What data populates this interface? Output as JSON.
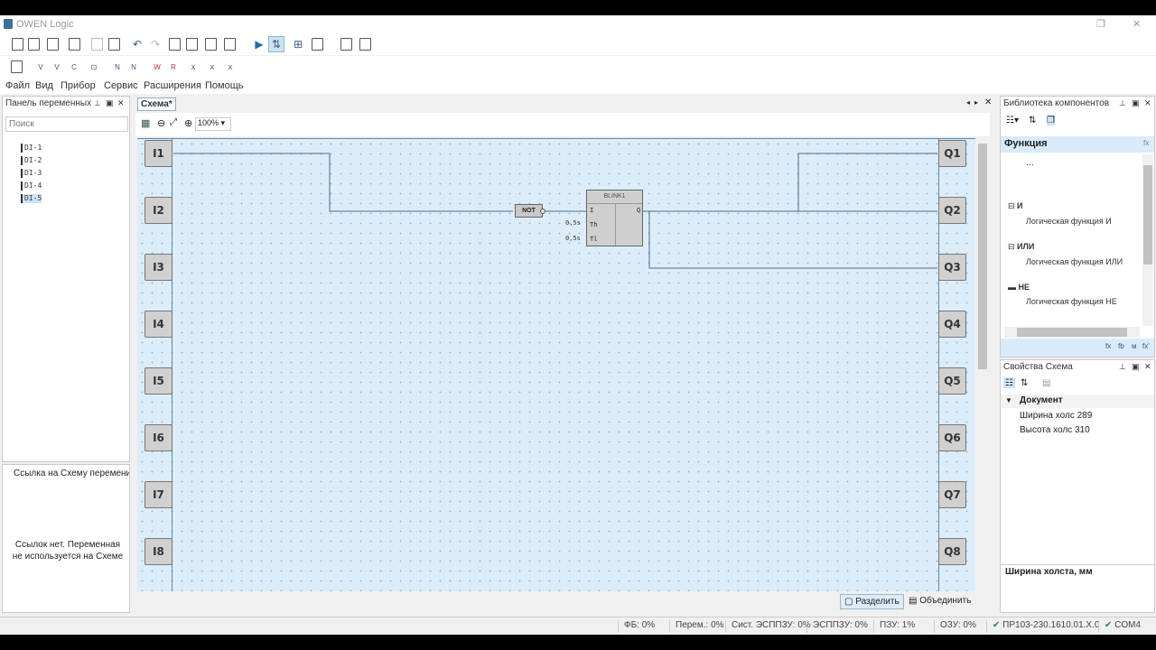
{
  "window": {
    "title": "OWEN Logic"
  },
  "toolbar1": [
    "new",
    "open",
    "save",
    "print",
    "copy",
    "paste",
    "undo",
    "redo",
    "find",
    "find-replace",
    "settings",
    "compile",
    "run",
    "step",
    "debug",
    "grid",
    "export",
    "view"
  ],
  "menu": [
    "Файл",
    "Вид",
    "Прибор",
    "Сервис",
    "Расширения",
    "Помощь"
  ],
  "vars_panel": {
    "title": "Панель переменных",
    "search_placeholder": "Поиск",
    "items": [
      "DI-1",
      "DI-2",
      "DI-3",
      "DI-4",
      "DI-5"
    ],
    "selected": "DI-5"
  },
  "links_panel": {
    "title": "Ссылка на Схему перемени",
    "empty_text": "Ссылок нет. Переменная не используется на Схеме"
  },
  "tab": {
    "label": "Схема*"
  },
  "zoom": {
    "value": "100%"
  },
  "inputs": [
    "I1",
    "I2",
    "I3",
    "I4",
    "I5",
    "I6",
    "I7",
    "I8"
  ],
  "outputs": [
    "Q1",
    "Q2",
    "Q3",
    "Q4",
    "Q5",
    "Q6",
    "Q7",
    "Q8"
  ],
  "blocks": {
    "not_label": "NOT",
    "blink_title": "BLINK1",
    "blink_in": "I",
    "blink_th": "Th",
    "blink_tl": "Tl",
    "blink_out": "Q",
    "th_val": "0,5s",
    "tl_val": "0,5s"
  },
  "bottom_buttons": {
    "split": "Разделить",
    "merge": "Объединить"
  },
  "library": {
    "title": "Библиотека компонентов",
    "category": "Функция",
    "category_icon": "fx",
    "items": [
      {
        "name": "И",
        "desc": "Логическая функция И"
      },
      {
        "name": "ИЛИ",
        "desc": "Логическая функция ИЛИ"
      },
      {
        "name": "НЕ",
        "desc": "Логическая функция НЕ"
      }
    ],
    "tabs": [
      "fx",
      "fb",
      "м",
      "fx'"
    ]
  },
  "props": {
    "title": "Свойства Схема",
    "section": "Документ",
    "rows": [
      "Ширина холс 289",
      "Высота холс 310"
    ],
    "desc_title": "Ширина холста, мм"
  },
  "status": [
    "ФБ: 0%",
    "Перем.: 0%",
    "Сист. ЭСППЗУ: 0%",
    "ЭСППЗУ: 0%",
    "ПЗУ: 1%",
    "ОЗУ: 0%",
    "ПР103-230.1610.01.Х.0",
    "COM4"
  ]
}
